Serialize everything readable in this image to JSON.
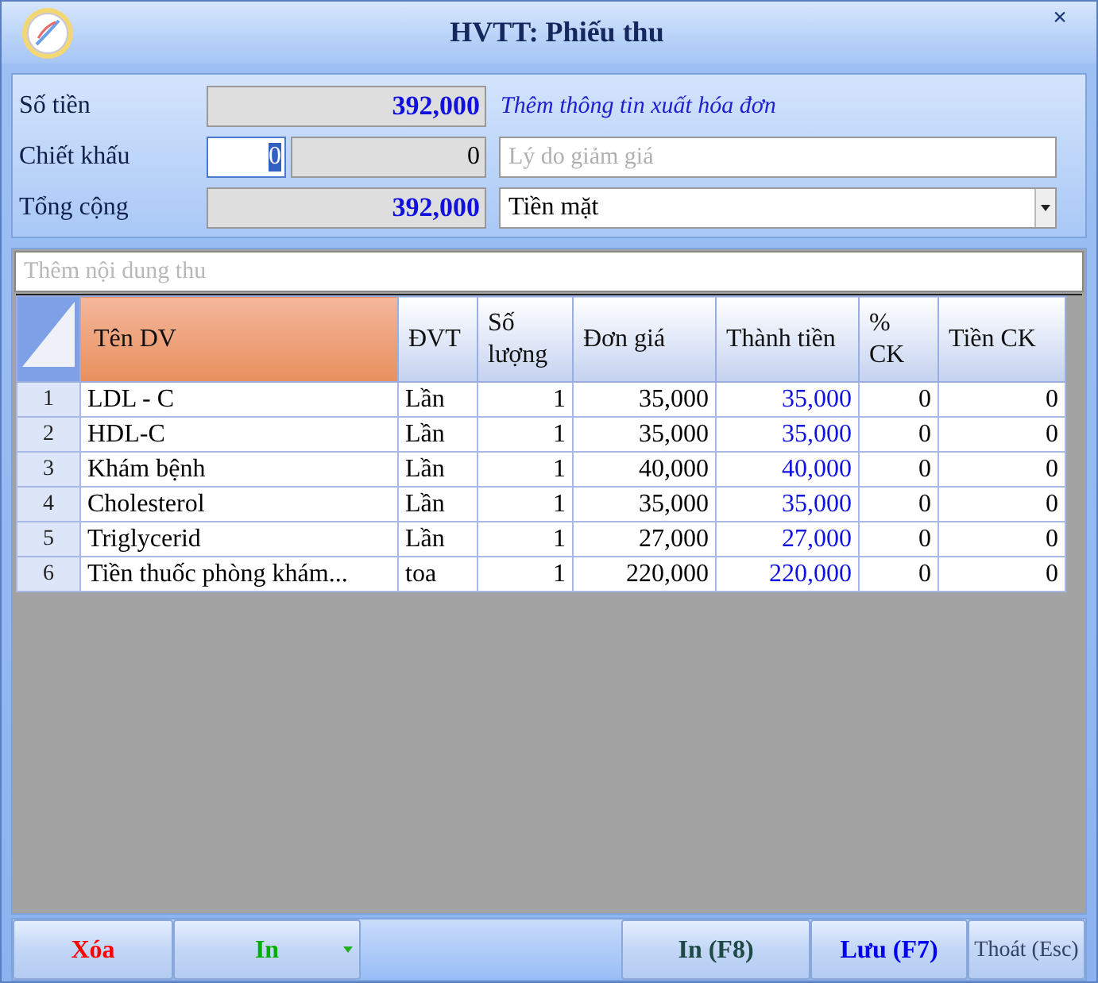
{
  "window": {
    "title": "HVTT: Phiếu thu",
    "close": "×"
  },
  "form": {
    "amount_label": "Số tiền",
    "amount": "392,000",
    "invoice_link": "Thêm thông tin xuất hóa đơn",
    "discount_label": "Chiết khấu",
    "discount_percent": "0",
    "discount_amount": "0",
    "discount_reason_placeholder": "Lý do giảm giá",
    "total_label": "Tổng cộng",
    "total": "392,000",
    "payment_method": "Tiền mặt"
  },
  "content_placeholder": "Thêm nội dung thu",
  "table": {
    "columns": [
      {
        "label": "Tên DV",
        "selected": true
      },
      {
        "label": "ĐVT",
        "selected": false
      },
      {
        "label": "Số lượng",
        "selected": false
      },
      {
        "label": "Đơn giá",
        "selected": false
      },
      {
        "label": "Thành tiền",
        "selected": false
      },
      {
        "label": "% CK",
        "selected": false
      },
      {
        "label": "Tiền CK",
        "selected": false
      }
    ],
    "rows": [
      {
        "number": "1",
        "cells": [
          "LDL - C",
          "Lần",
          "1",
          "35,000",
          "35,000",
          "0",
          "0"
        ]
      },
      {
        "number": "2",
        "cells": [
          "HDL-C",
          "Lần",
          "1",
          "35,000",
          "35,000",
          "0",
          "0"
        ]
      },
      {
        "number": "3",
        "cells": [
          "Khám bệnh",
          "Lần",
          "1",
          "40,000",
          "40,000",
          "0",
          "0"
        ]
      },
      {
        "number": "4",
        "cells": [
          "Cholesterol",
          "Lần",
          "1",
          "35,000",
          "35,000",
          "0",
          "0"
        ]
      },
      {
        "number": "5",
        "cells": [
          "Triglycerid",
          "Lần",
          "1",
          "27,000",
          "27,000",
          "0",
          "0"
        ]
      },
      {
        "number": "6",
        "cells": [
          "Tiền thuốc phòng khám...",
          "toa",
          "1",
          "220,000",
          "220,000",
          "0",
          "0"
        ]
      }
    ]
  },
  "buttons": [
    {
      "label": "Xóa",
      "kind": "action",
      "color": "#ff0000"
    },
    {
      "label": "In",
      "kind": "dropdown",
      "color": "#00b000"
    },
    {
      "kind": "spacer"
    },
    {
      "label": "In (F8)",
      "kind": "action",
      "color": "#1d4a45"
    },
    {
      "label": "Lưu (F7)",
      "kind": "action",
      "color": "#0000ee"
    },
    {
      "label": "Thoát (Esc)",
      "kind": "exit",
      "color": "#334466"
    }
  ]
}
